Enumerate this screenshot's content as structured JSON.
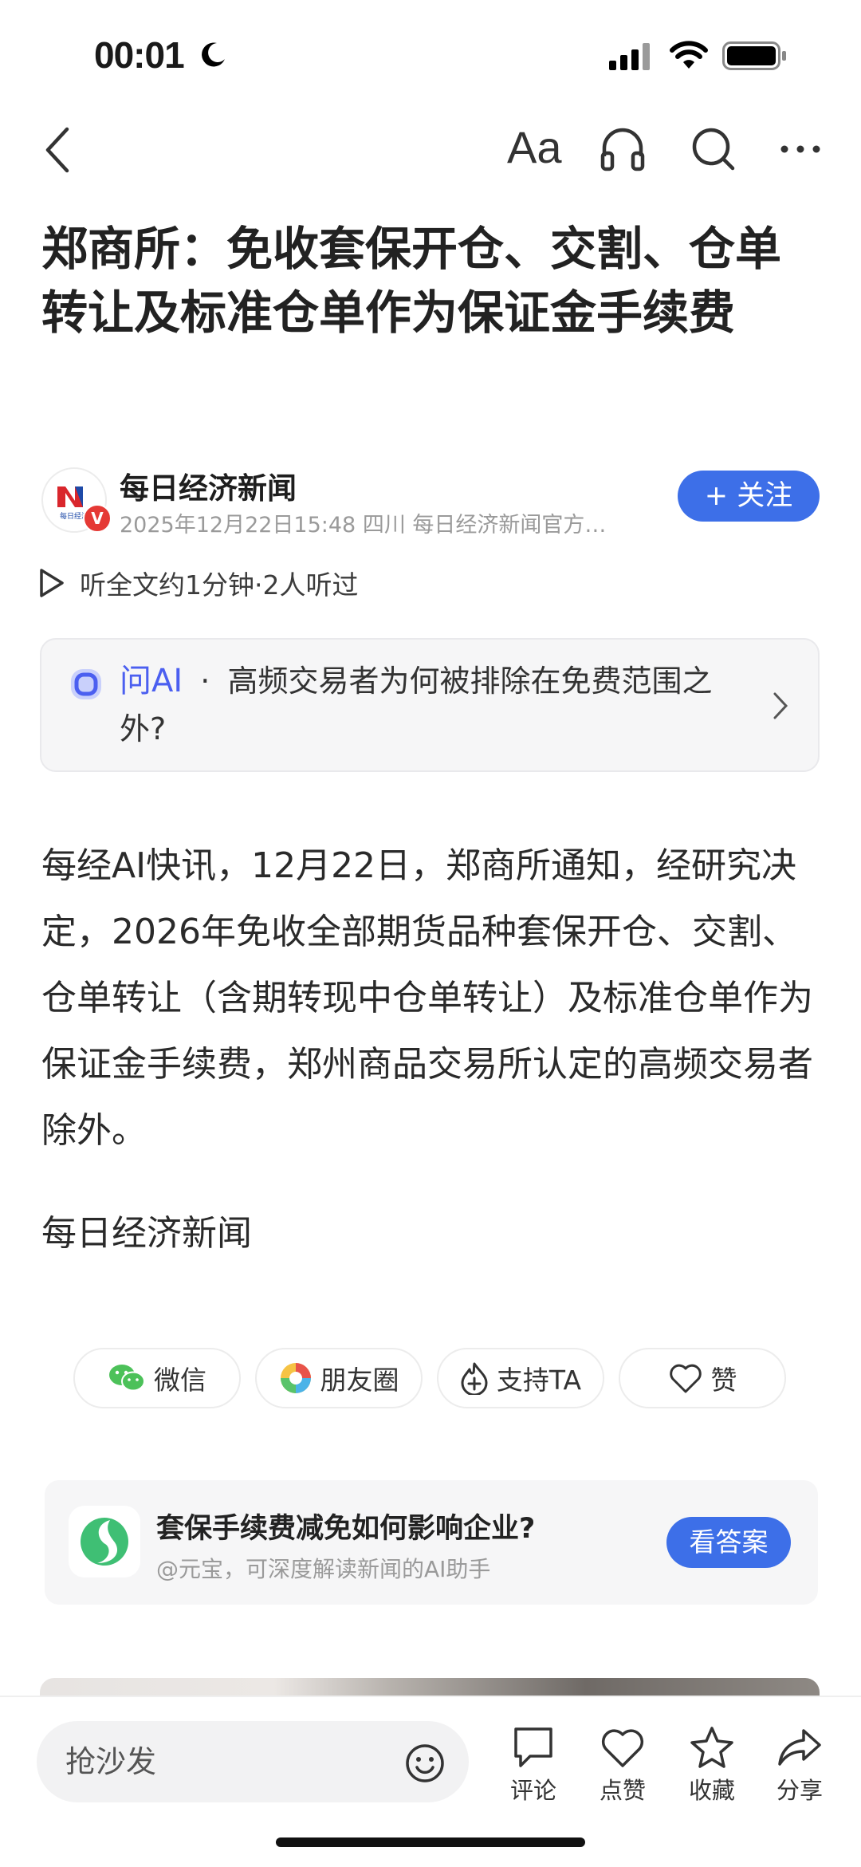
{
  "status_bar": {
    "time": "00:01"
  },
  "nav": {
    "font_size_label": "Aa"
  },
  "article": {
    "title": "郑商所：免收套保开仓、交割、仓单转让及标准仓单作为保证金手续费",
    "author": "每日经济新闻",
    "author_logo_text": "每日经济",
    "verified_badge": "V",
    "meta": "2025年12月22日15:48 四川 每日经济新闻官方…",
    "follow_label": "+ 关注",
    "listen_info": "听全文约1分钟·2人听过",
    "body": "每经AI快讯，12月22日，郑商所通知，经研究决定，2026年免收全部期货品种套保开仓、交割、仓单转让（含期转现中仓单转让）及标准仓单作为保证金手续费，郑州商品交易所认定的高频交易者除外。",
    "source": "每日经济新闻"
  },
  "ask_ai": {
    "label": "问AI",
    "separator": "·",
    "question": "高频交易者为何被排除在免费范围之外?"
  },
  "share": {
    "wechat": "微信",
    "moments": "朋友圈",
    "support": "支持TA",
    "like": "赞"
  },
  "yuanbao": {
    "title": "套保手续费减免如何影响企业?",
    "subtitle": "@元宝，可深度解读新闻的AI助手",
    "button": "看答案"
  },
  "bottom_bar": {
    "comment_placeholder": "抢沙发",
    "comment_label": "评论",
    "like_label": "点赞",
    "favorite_label": "收藏",
    "share_label": "分享"
  },
  "colors": {
    "accent": "#3d6fe8",
    "ai_label": "#4b5ff0",
    "wechat_green": "#4cc159"
  }
}
